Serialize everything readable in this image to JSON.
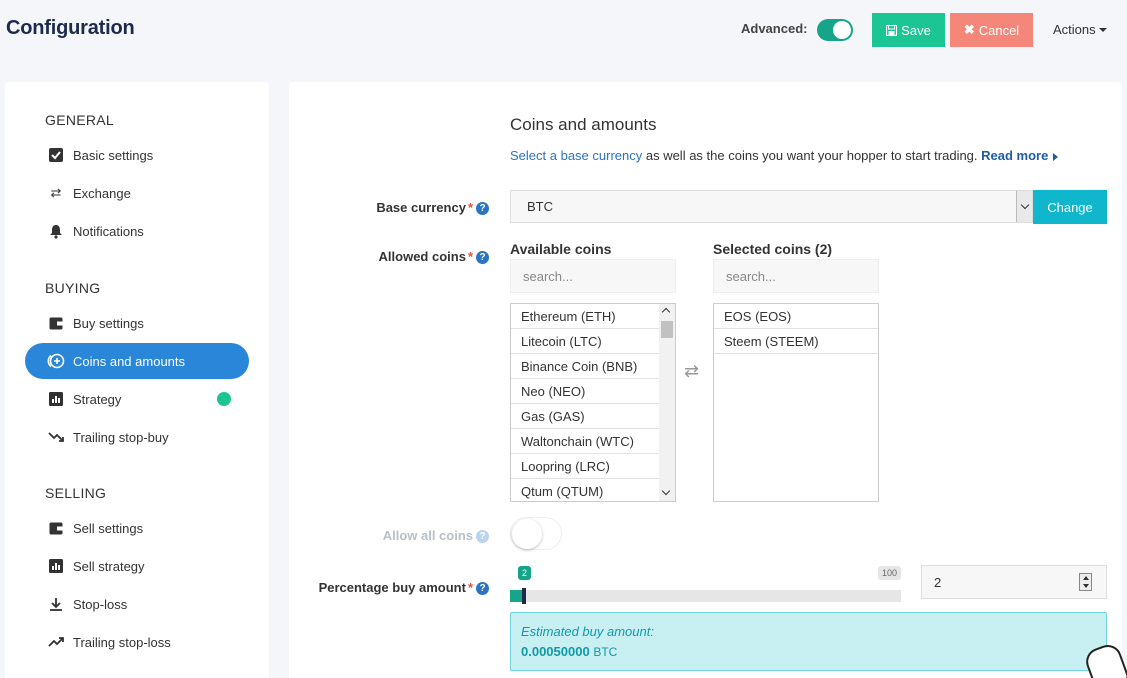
{
  "header": {
    "title": "Configuration",
    "advanced_label": "Advanced:",
    "advanced_on": true,
    "save_label": "Save",
    "cancel_label": "Cancel",
    "actions_label": "Actions"
  },
  "sidebar": {
    "sections": [
      {
        "heading": "GENERAL",
        "items": [
          {
            "label": "Basic settings",
            "icon": "checkbox-icon"
          },
          {
            "label": "Exchange",
            "icon": "swap-arrows-icon"
          },
          {
            "label": "Notifications",
            "icon": "bell-icon"
          }
        ]
      },
      {
        "heading": "BUYING",
        "items": [
          {
            "label": "Buy settings",
            "icon": "wallet-icon"
          },
          {
            "label": "Coins and amounts",
            "icon": "coins-plus-icon",
            "active": true
          },
          {
            "label": "Strategy",
            "icon": "bar-chart-icon",
            "status_dot": true
          },
          {
            "label": "Trailing stop-buy",
            "icon": "trend-down-icon"
          }
        ]
      },
      {
        "heading": "SELLING",
        "items": [
          {
            "label": "Sell settings",
            "icon": "wallet-icon"
          },
          {
            "label": "Sell strategy",
            "icon": "bar-chart-icon"
          },
          {
            "label": "Stop-loss",
            "icon": "download-arrow-icon"
          },
          {
            "label": "Trailing stop-loss",
            "icon": "trend-up-icon"
          }
        ]
      }
    ],
    "colors": {
      "active": "#2a86d9",
      "status_dot": "#1bc594"
    }
  },
  "main": {
    "section_title": "Coins and amounts",
    "desc_link": "Select a base currency",
    "desc_text": " as well as the coins you want your hopper to start trading. ",
    "read_more": "Read more",
    "base_currency": {
      "label": "Base currency",
      "value": "BTC",
      "change_label": "Change"
    },
    "allowed_coins": {
      "label": "Allowed coins",
      "available_heading": "Available coins",
      "selected_heading": "Selected coins (2)",
      "search_placeholder": "search...",
      "available": [
        "Ethereum (ETH)",
        "Litecoin (LTC)",
        "Binance Coin (BNB)",
        "Neo (NEO)",
        "Gas (GAS)",
        "Waltonchain (WTC)",
        "Loopring (LRC)",
        "Qtum (QTUM)"
      ],
      "selected": [
        "EOS (EOS)",
        "Steem (STEEM)"
      ]
    },
    "allow_all": {
      "label": "Allow all coins",
      "on": false
    },
    "percentage": {
      "label": "Percentage buy amount",
      "value": "2",
      "min_label": "2",
      "max_label": "100",
      "fraction": 0.02
    },
    "estimate": {
      "label": "Estimated buy amount:",
      "value": "0.00050000",
      "currency": "BTC"
    }
  },
  "colors": {
    "save": "#1bc594",
    "cancel": "#f5867a",
    "change": "#0fb6cc",
    "toggle": "#17a589",
    "estimate_bg": "#c8f0f3"
  }
}
